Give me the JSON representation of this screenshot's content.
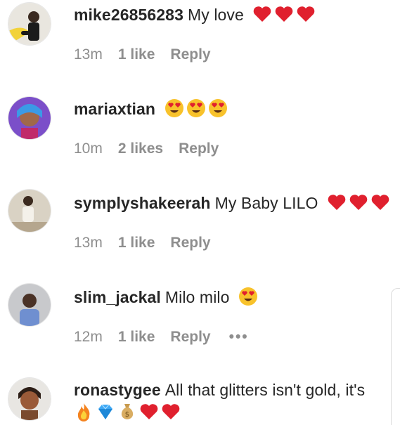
{
  "comments": [
    {
      "username": "mike26856283",
      "text": "My love",
      "emojis": [
        "red-heart",
        "red-heart",
        "red-heart"
      ],
      "time": "13m",
      "likes": "1 like",
      "reply": "Reply"
    },
    {
      "username": "mariaxtian",
      "text": "",
      "emojis": [
        "heart-eyes",
        "heart-eyes",
        "heart-eyes"
      ],
      "time": "10m",
      "likes": "2 likes",
      "reply": "Reply"
    },
    {
      "username": "symplyshakeerah",
      "text": "My Baby LILO",
      "emojis": [
        "red-heart",
        "red-heart",
        "red-heart"
      ],
      "time": "13m",
      "likes": "1 like",
      "reply": "Reply"
    },
    {
      "username": "slim_jackal",
      "text": "Milo milo",
      "emojis": [
        "heart-eyes"
      ],
      "time": "12m",
      "likes": "1 like",
      "reply": "Reply",
      "more": "•••"
    },
    {
      "username": "ronastygee",
      "text": "All that glitters isn't gold, it's",
      "emojis": [
        "fire",
        "gem-stone",
        "money-bag",
        "red-heart",
        "red-heart"
      ]
    }
  ],
  "colors": {
    "meta_text": "#8e8e8e",
    "heart": "#e0202e",
    "face": "#f8c22b"
  }
}
